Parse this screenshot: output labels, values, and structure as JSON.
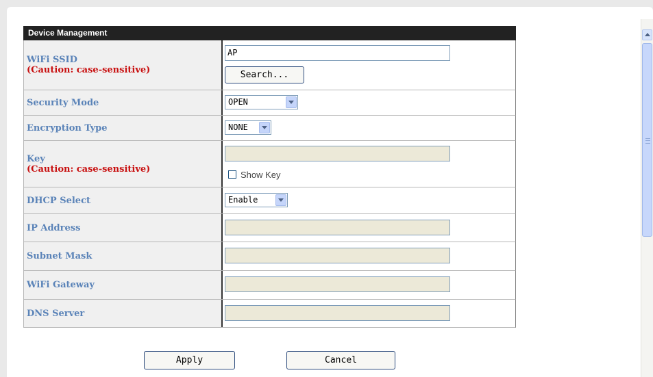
{
  "panel": {
    "title": "Device Management"
  },
  "form": {
    "wifi_ssid": {
      "label": "WiFi SSID",
      "caution": "(Caution: case-sensitive)",
      "value": "AP",
      "search_button": "Search..."
    },
    "security_mode": {
      "label": "Security Mode",
      "value": "OPEN"
    },
    "encryption_type": {
      "label": "Encryption Type",
      "value": "NONE"
    },
    "key": {
      "label": "Key",
      "caution": "(Caution: case-sensitive)",
      "value": "",
      "show_key_label": "Show Key",
      "show_key_checked": false
    },
    "dhcp_select": {
      "label": "DHCP Select",
      "value": "Enable"
    },
    "ip_address": {
      "label": "IP Address",
      "value": ""
    },
    "subnet_mask": {
      "label": "Subnet Mask",
      "value": ""
    },
    "wifi_gateway": {
      "label": "WiFi Gateway",
      "value": ""
    },
    "dns_server": {
      "label": "DNS Server",
      "value": ""
    }
  },
  "actions": {
    "apply": "Apply",
    "cancel": "Cancel"
  },
  "icons": {
    "scroll_up": "chevron-up-icon",
    "dropdown": "chevron-down-icon",
    "checkbox": "checkbox-icon"
  },
  "colors": {
    "label_text": "#5a83b8",
    "caution_text": "#c81010",
    "header_bg": "#222222",
    "disabled_field": "#ece9d8"
  }
}
